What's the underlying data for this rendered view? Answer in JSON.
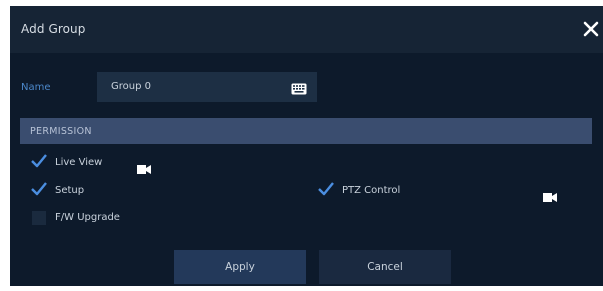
{
  "dialog": {
    "title": "Add Group",
    "close_icon": "close-icon"
  },
  "name": {
    "label": "Name",
    "value": "Group 0",
    "keyboard_icon": "keyboard-icon"
  },
  "permission": {
    "header": "PERMISSION",
    "items": [
      {
        "label": "Live View",
        "checked": true,
        "icon": "camera-icon"
      },
      {
        "label": "Setup",
        "checked": true
      },
      {
        "label": "PTZ Control",
        "checked": true,
        "icon": "camera-icon"
      },
      {
        "label": "F/W Upgrade",
        "checked": false
      }
    ]
  },
  "buttons": {
    "apply": "Apply",
    "cancel": "Cancel"
  },
  "colors": {
    "background": "#0d1a2b",
    "titlebar": "#162435",
    "section_header": "#3a4d6f",
    "accent": "#4b87c9"
  }
}
